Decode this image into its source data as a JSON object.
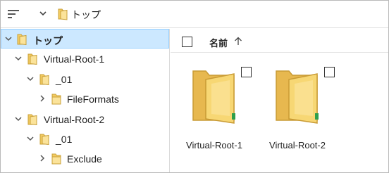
{
  "toolbar": {
    "sort_icon": "sort-lines-icon",
    "expand_icon": "chevron-down-icon",
    "breadcrumb_icon": "folder-icon",
    "breadcrumb_label": "トップ"
  },
  "tree": {
    "items": [
      {
        "label": "トップ",
        "expanded": true,
        "selected": true
      },
      {
        "label": "Virtual-Root-1",
        "expanded": true
      },
      {
        "label": "_01",
        "expanded": true
      },
      {
        "label": "FileFormats",
        "expanded": false
      },
      {
        "label": "Virtual-Root-2",
        "expanded": true
      },
      {
        "label": "_01",
        "expanded": true
      },
      {
        "label": "Exclude",
        "expanded": false
      }
    ]
  },
  "content": {
    "header": {
      "name_label": "名前",
      "sort_icon": "arrow-up-icon"
    },
    "items": [
      {
        "label": "Virtual-Root-1",
        "icon": "folder-icon"
      },
      {
        "label": "Virtual-Root-2",
        "icon": "folder-icon"
      }
    ]
  },
  "colors": {
    "selection_bg": "#cce8ff",
    "selection_border": "#99d1ff",
    "folder_yellow": "#f7d774",
    "folder_dark": "#e0b54a"
  }
}
